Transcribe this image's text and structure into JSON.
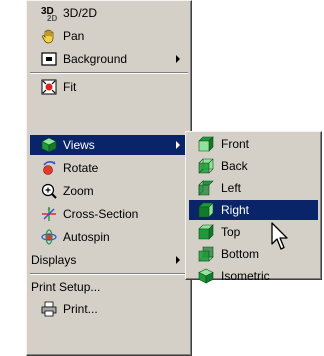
{
  "main_menu": {
    "items": [
      {
        "label": "3D/2D",
        "icon": "3d-2d-icon"
      },
      {
        "label": "Pan",
        "icon": "hand-icon"
      },
      {
        "label": "Background",
        "icon": "background-icon",
        "has_submenu": true
      },
      {
        "label": "Fit",
        "icon": "fit-icon"
      },
      {
        "label": "Views",
        "icon": "views-cube-icon",
        "has_submenu": true,
        "highlighted": true
      },
      {
        "label": "Rotate",
        "icon": "rotate-icon"
      },
      {
        "label": "Zoom",
        "icon": "zoom-icon"
      },
      {
        "label": "Cross-Section",
        "icon": "cross-section-icon"
      },
      {
        "label": "Autospin",
        "icon": "autospin-icon"
      },
      {
        "label": "Displays",
        "has_submenu": true
      },
      {
        "label": "Print Setup..."
      },
      {
        "label": "Print...",
        "icon": "printer-icon"
      }
    ]
  },
  "views_submenu": {
    "items": [
      {
        "label": "Front",
        "icon": "cube-front-icon"
      },
      {
        "label": "Back",
        "icon": "cube-back-icon"
      },
      {
        "label": "Left",
        "icon": "cube-left-icon"
      },
      {
        "label": "Right",
        "icon": "cube-right-icon",
        "highlighted": true
      },
      {
        "label": "Top",
        "icon": "cube-top-icon"
      },
      {
        "label": "Bottom",
        "icon": "cube-bottom-icon"
      },
      {
        "label": "Isometric",
        "icon": "cube-isometric-icon"
      }
    ]
  },
  "colors": {
    "menu_face": "#d4d0c8",
    "highlight": "#0a246a",
    "highlight_text": "#ffffff",
    "cube_green": "#1f9a3a",
    "cube_face_highlight": "#7fdc8f"
  }
}
